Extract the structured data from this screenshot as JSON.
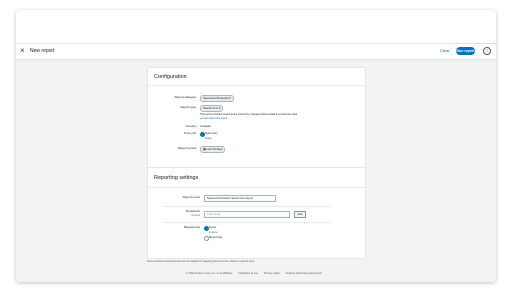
{
  "header": {
    "title": "New report",
    "clear_label": "Clear",
    "run_label": "Run report",
    "help_glyph": "?"
  },
  "configuration": {
    "title": "Configuration",
    "category_label": "Report category",
    "category_value": "Sponsored Products",
    "type_label": "Report type",
    "type_value": "Search term",
    "type_description": "This report provides search terms entered by shoppers that resulted in at least one click.",
    "learn_more": "Learn about this report",
    "country_label": "Country",
    "country_value": "Canada",
    "time_unit_label": "Time unit",
    "time_unit_options": [
      "Summary",
      "Daily"
    ],
    "report_period_label": "Report period",
    "report_period_value": "Last 30 days"
  },
  "reporting_settings": {
    "title": "Reporting settings",
    "name_label": "Report name",
    "name_value": "Sponsored Products Search term report",
    "recipients_label": "Recipients",
    "recipients_sub": "optional",
    "email_placeholder": "Enter email",
    "add_label": "Add",
    "repeat_label": "Repeat time",
    "repeat_options": [
      "Once",
      "Future",
      "Recurring"
    ]
  },
  "note": "Some products and keywords are not eligible for targeting and won't be shown in search term.",
  "footer": {
    "copyright": "© 2023 Amazon.com, Inc. or its affiliates",
    "conditions": "Conditions of use",
    "privacy": "Privacy notice",
    "agreement": "Amazon Advertising Agreement"
  },
  "colors": {
    "accent": "#0073bb",
    "page_bg": "#f2f3f3",
    "card_bg": "#ffffff"
  }
}
